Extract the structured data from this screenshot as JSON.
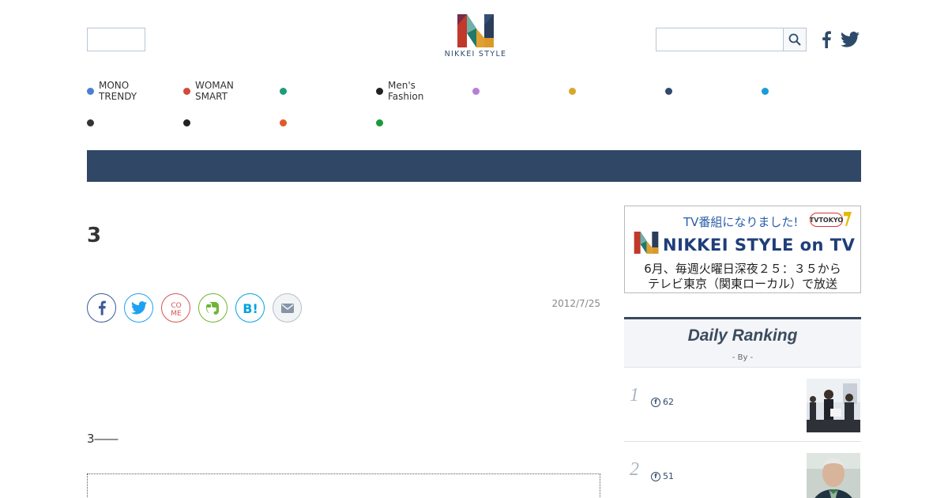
{
  "header": {
    "logo_text": "NIKKEI STYLE",
    "search": {
      "placeholder": "",
      "value": ""
    },
    "social": [
      "facebook-icon",
      "twitter-icon"
    ]
  },
  "categories": [
    {
      "label": "MONO\nTRENDY",
      "color": "#4a7fd0"
    },
    {
      "label": "WOMAN\nSMART",
      "color": "#d14a3c"
    },
    {
      "label": "",
      "color": "#1f9c7a"
    },
    {
      "label": "Men's\nFashion",
      "color": "#222222"
    },
    {
      "label": "",
      "color": "#b47fd8"
    },
    {
      "label": "",
      "color": "#d9a72a"
    },
    {
      "label": "",
      "color": "#34486e"
    },
    {
      "label": "",
      "color": "#1d9bd7"
    },
    {
      "label": "",
      "color": "#333333"
    },
    {
      "label": "",
      "color": "#222222"
    },
    {
      "label": "",
      "color": "#e05a2a"
    },
    {
      "label": "",
      "color": "#1a9a3a"
    }
  ],
  "article": {
    "title": "3",
    "date": "2012/7/25",
    "lead": "3――",
    "share_buttons": [
      {
        "name": "facebook",
        "color": "#3b5998"
      },
      {
        "name": "twitter",
        "color": "#1da1f2"
      },
      {
        "name": "come",
        "color": "#d9534f"
      },
      {
        "name": "evernote",
        "color": "#6fb536"
      },
      {
        "name": "hatena",
        "color": "#00a4de"
      },
      {
        "name": "mail",
        "color": "#7a8a9a"
      }
    ]
  },
  "tv_banner": {
    "top_text": "TV番組になりました!",
    "badge": "TVTOKYO",
    "title": "NIKKEI STYLE on TV",
    "line1": "6月、毎週火曜日深夜２５：３５から",
    "line2": "テレビ東京（関東ローカル）で放送"
  },
  "ranking": {
    "title": "Daily Ranking",
    "subtitle": "- By  -",
    "items": [
      {
        "rank": "1",
        "fb_count": "62"
      },
      {
        "rank": "2",
        "fb_count": "51"
      }
    ]
  },
  "colors": {
    "nav_bar": "#304766",
    "accent": "#2e4a6b"
  }
}
